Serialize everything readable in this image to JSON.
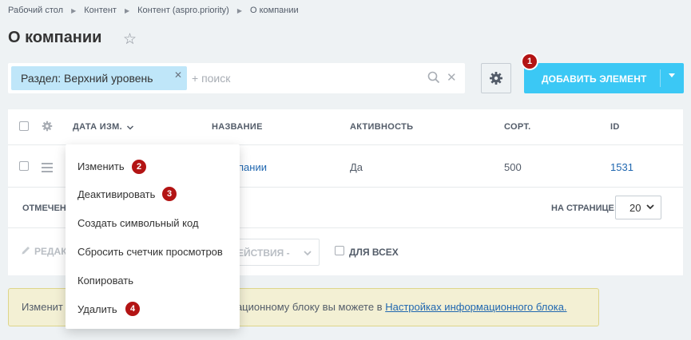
{
  "breadcrumbs": [
    "Рабочий стол",
    "Контент",
    "Контент (aspro.priority)",
    "О компании"
  ],
  "page_title": "О компании",
  "filter": {
    "chip_label": "Раздел: Верхний уровень",
    "search_placeholder": "+ поиск"
  },
  "add_button_label": "ДОБАВИТЬ ЭЛЕМЕНТ",
  "table": {
    "headers": [
      "ДАТА ИЗМ.",
      "НАЗВАНИЕ",
      "АКТИВНОСТЬ",
      "СОРТ.",
      "ID"
    ],
    "row": {
      "name": "пании",
      "active": "Да",
      "sort": "500",
      "id": "1531"
    },
    "marked_label": "ОТМЕЧЕН",
    "per_page_label": "НА СТРАНИЦЕ:",
    "per_page_value": "20",
    "edit_label": "РЕДАК",
    "actions_label": "ЕЙСТВИЯ -",
    "for_all_label": "ДЛЯ ВСЕХ"
  },
  "notice": {
    "prefix": "Изменит",
    "middle": "мационному блоку вы можете в ",
    "link": "Настройках информационного блока."
  },
  "context_menu": {
    "items": [
      "Изменить",
      "Деактивировать",
      "Создать символьный код",
      "Сбросить счетчик просмотров",
      "Копировать",
      "Удалить"
    ]
  },
  "badges": [
    "1",
    "2",
    "3",
    "4"
  ],
  "colors": {
    "accent": "#3bc8f5",
    "badge": "#b31414",
    "chip": "#bfe6f9",
    "link": "#2067b0",
    "notice_bg": "#f3f0d4"
  }
}
